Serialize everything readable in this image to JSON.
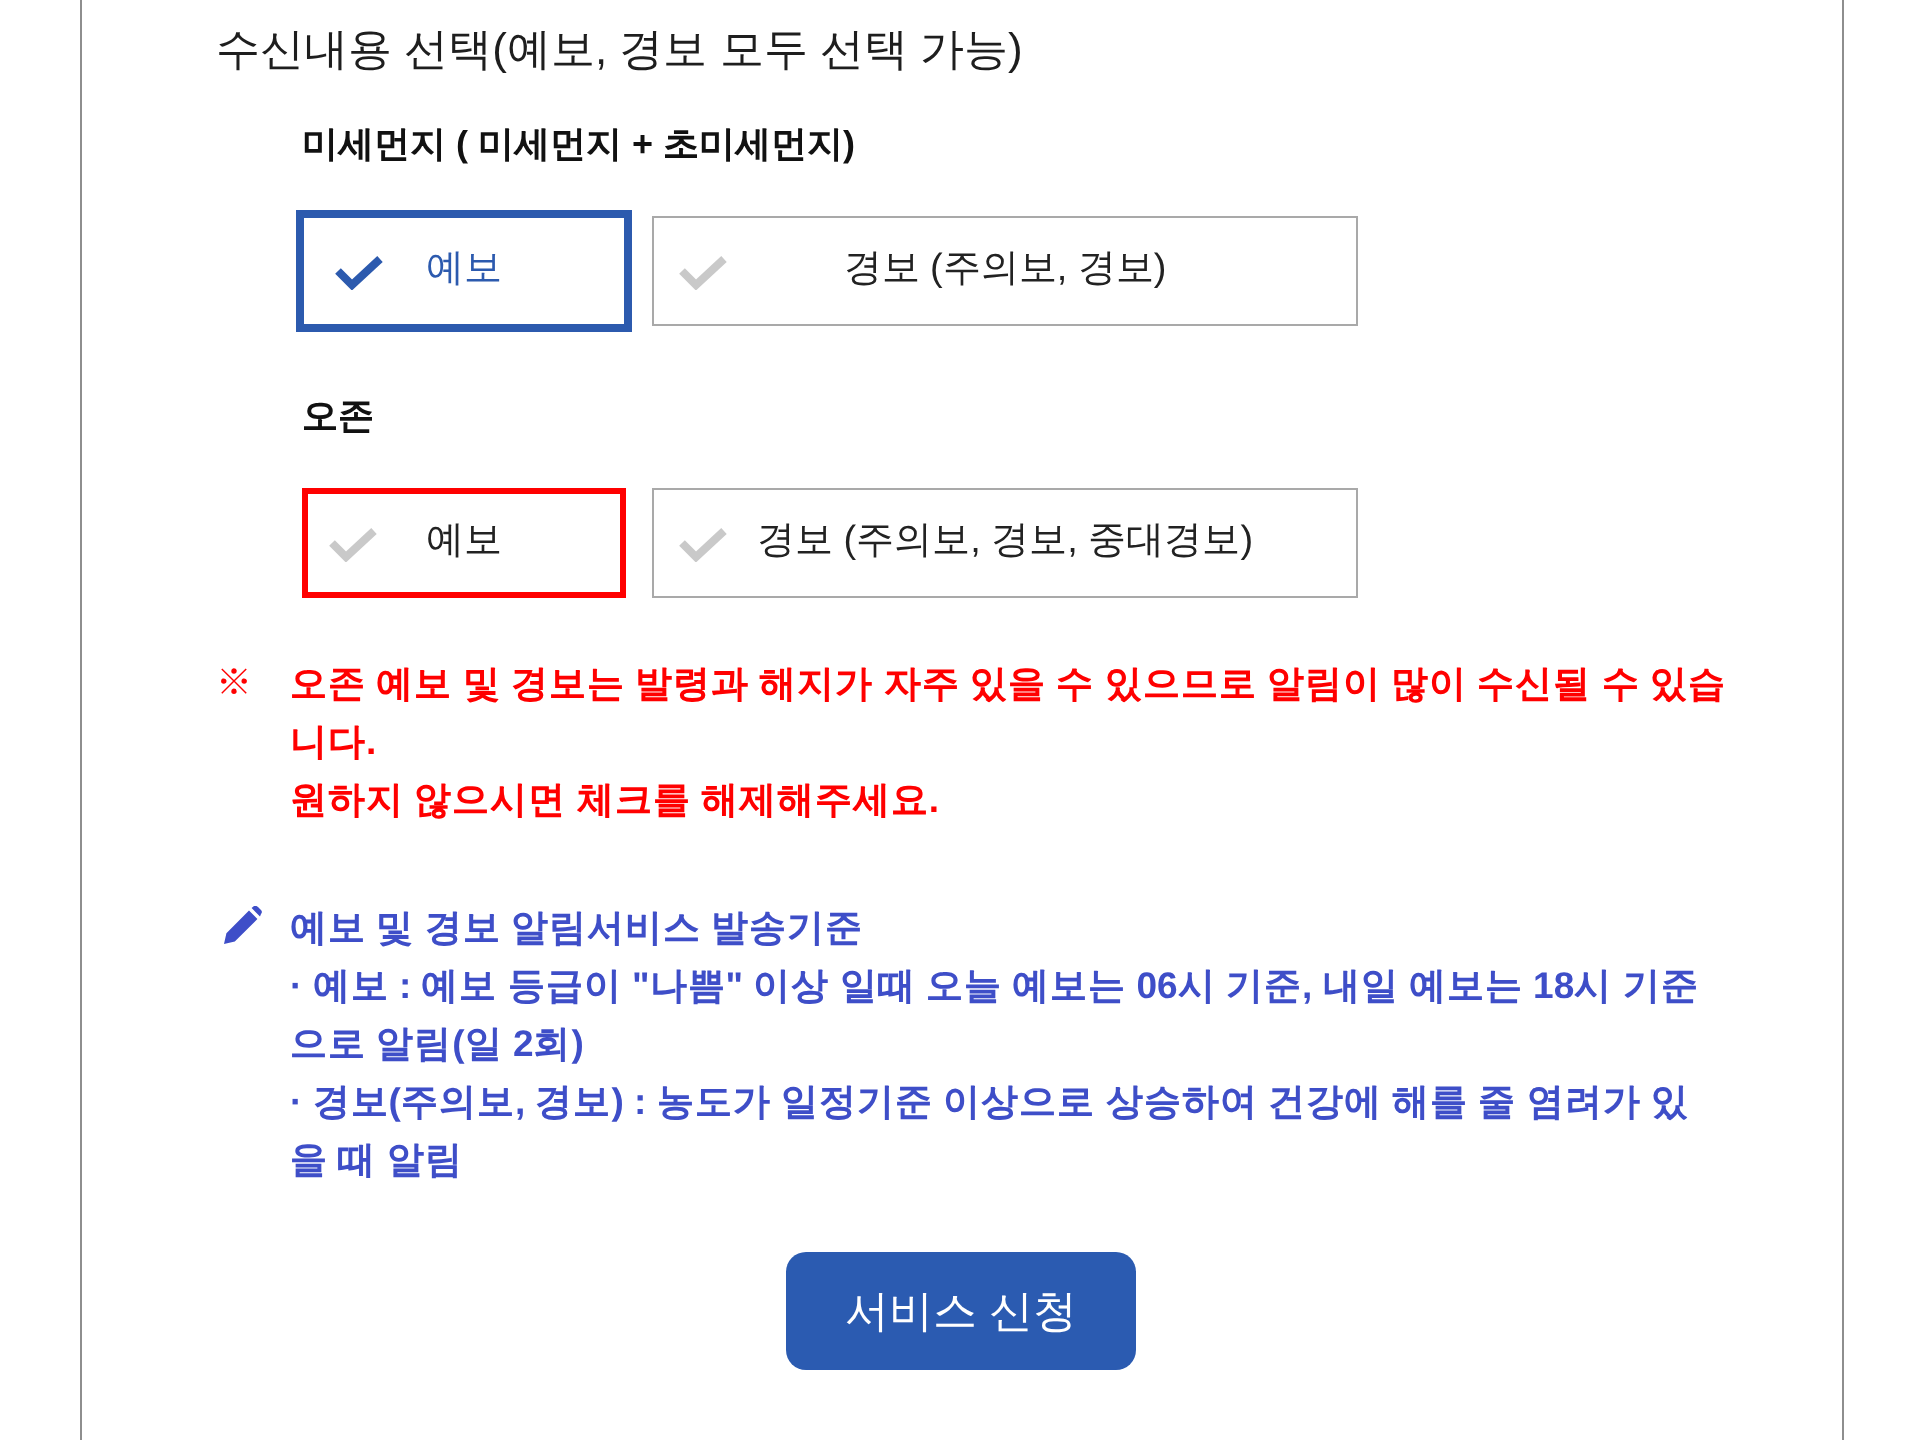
{
  "heading": "수신내용 선택(예보, 경보 모두 선택 가능)",
  "groups": [
    {
      "title": "미세먼지 ( 미세먼지 + 초미세먼지)",
      "options": [
        {
          "label": "예보",
          "checked": true,
          "highlighted": false
        },
        {
          "label": "경보 (주의보, 경보)",
          "checked": false,
          "highlighted": false
        }
      ]
    },
    {
      "title": "오존",
      "options": [
        {
          "label": "예보",
          "checked": false,
          "highlighted": true
        },
        {
          "label": "경보 (주의보, 경보, 중대경보)",
          "checked": false,
          "highlighted": false
        }
      ]
    }
  ],
  "warning": {
    "mark": "※",
    "lines": [
      "오존 예보 및 경보는 발령과 해지가 자주 있을 수 있으므로 알림이 많이 수신될 수 있습니다.",
      "원하지 않으시면 체크를 해제해주세요."
    ]
  },
  "info": {
    "title": "예보 및 경보 알림서비스 발송기준",
    "items": [
      "· 예보 : 예보 등급이 \"나쁨\" 이상 일때 오늘 예보는 06시 기준, 내일 예보는 18시 기준으로 알림(일 2회)",
      "· 경보(주의보, 경보) : 농도가 일정기준 이상으로 상승하여 건강에 해를 줄 염려가 있을 때 알림"
    ]
  },
  "submit_button": "서비스 신청"
}
